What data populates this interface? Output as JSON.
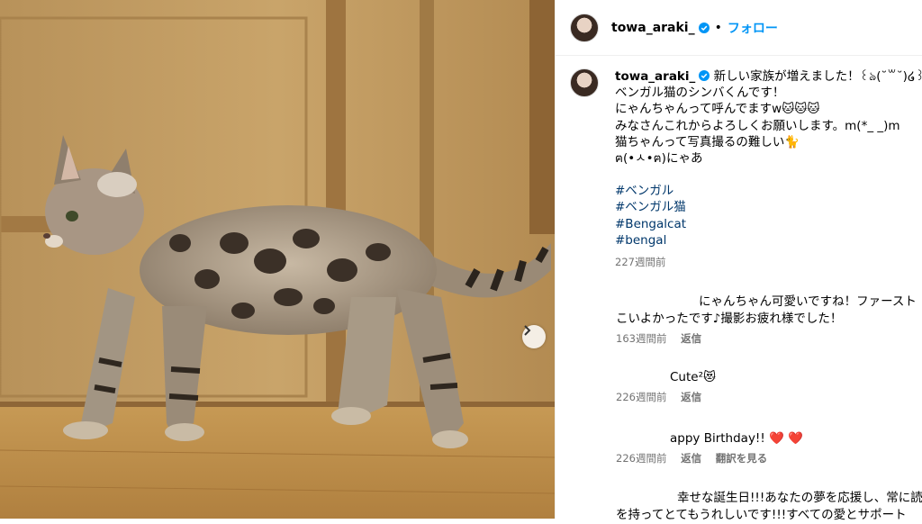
{
  "post": {
    "username": "towa_araki_",
    "follow_label": "フォロー",
    "dot": "•",
    "caption_lines": [
      "新しい家族が増えました！꒰ঌ(˘꒳˘)໒꒱",
      "ベンガル猫のシンバくんです！",
      "にゃんちゃんって呼んでますw🐱🐱🐱",
      "みなさんこれからよろしくお願いします。m(*_ _)m",
      "猫ちゃんって写真撮るの難しい🐈",
      "ฅ(•ㅅ•ฅ)にゃあ"
    ],
    "hashtags": [
      "#ベンガル",
      "#ベンガル猫",
      "#Bengalcat",
      "#bengal"
    ],
    "time_ago": "227週間前"
  },
  "comments": [
    {
      "lines": [
        "にゃんちゃん可愛いですね！ファースト",
        "こいよかったです♪撮影お疲れ様でした！"
      ],
      "time": "163週間前",
      "reply": "返信"
    },
    {
      "lines": [
        "Cute²😻"
      ],
      "time": "226週間前",
      "reply": "返信"
    },
    {
      "lines": [
        "appy Birthday!! ❤️ ❤️"
      ],
      "time": "226週間前",
      "reply": "返信",
      "translate": "翻訳を見る"
    },
    {
      "lines": [
        "幸せな誕生日!!!あなたの夢を応援し、常に読",
        "を持ってとてもうれしいです!!!すべての愛とサポート"
      ]
    }
  ],
  "colors": {
    "accent": "#0095f6",
    "hashtag": "#00376b",
    "meta": "#737373"
  },
  "icons": {
    "verified": "verified-badge-icon",
    "next": "chevron-right-icon"
  }
}
